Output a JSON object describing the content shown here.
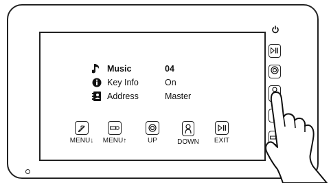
{
  "menu": {
    "items": [
      {
        "icon": "music-note-icon",
        "label": "Music",
        "value": "04",
        "selected": true
      },
      {
        "icon": "info-icon",
        "label": "Key Info",
        "value": "On",
        "selected": false
      },
      {
        "icon": "address-book-icon",
        "label": "Address",
        "value": "Master",
        "selected": false
      }
    ]
  },
  "buttons": {
    "menu_down": "MENU↓",
    "menu_up": "MENU↑",
    "up": "UP",
    "down": "DOWN",
    "exit": "EXIT"
  },
  "side_buttons": [
    "play-pause-icon",
    "intercom-icon",
    "door-person-icon",
    "monitor-icon",
    "key-icon"
  ]
}
